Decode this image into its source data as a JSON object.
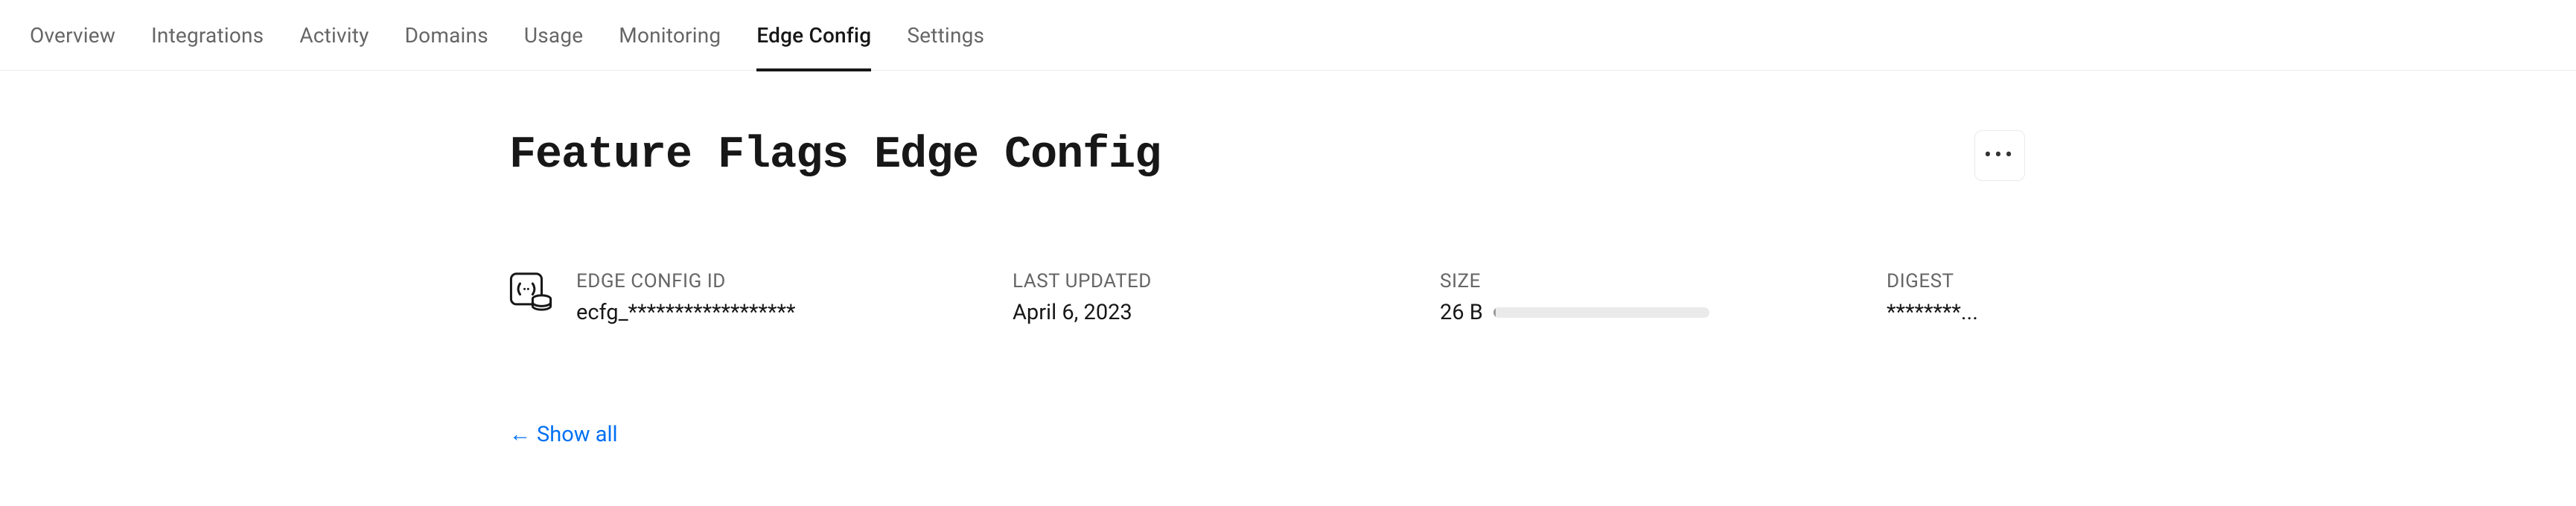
{
  "tabs": {
    "items": [
      {
        "label": "Overview",
        "active": false
      },
      {
        "label": "Integrations",
        "active": false
      },
      {
        "label": "Activity",
        "active": false
      },
      {
        "label": "Domains",
        "active": false
      },
      {
        "label": "Usage",
        "active": false
      },
      {
        "label": "Monitoring",
        "active": false
      },
      {
        "label": "Edge Config",
        "active": true
      },
      {
        "label": "Settings",
        "active": false
      }
    ]
  },
  "header": {
    "title": "Feature Flags Edge Config"
  },
  "info": {
    "id_label": "EDGE CONFIG ID",
    "id_value": "ecfg_******************",
    "updated_label": "LAST UPDATED",
    "updated_value": "April 6, 2023",
    "size_label": "SIZE",
    "size_value": "26 B",
    "digest_label": "DIGEST",
    "digest_value": "********..."
  },
  "actions": {
    "show_all": "Show all",
    "arrow": "←"
  }
}
